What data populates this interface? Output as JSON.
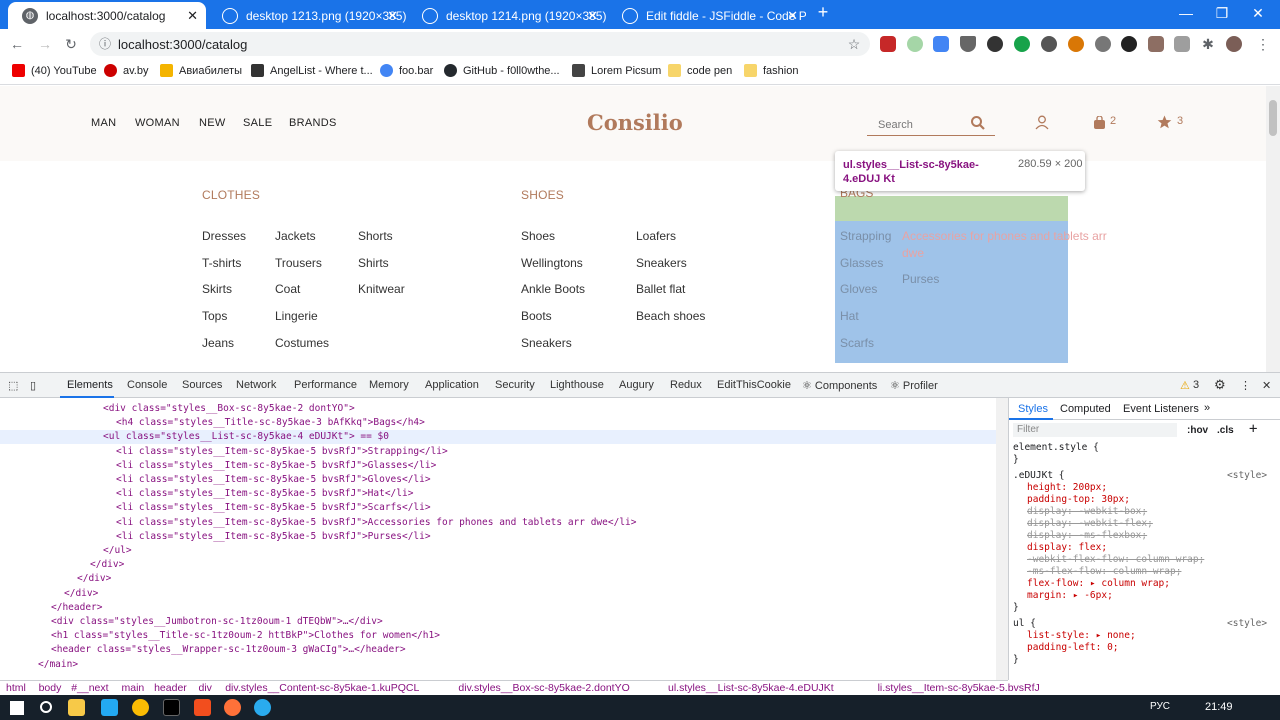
{
  "browser": {
    "tabs": [
      {
        "title": "localhost:3000/catalog",
        "active": true
      },
      {
        "title": "desktop 1213.png (1920×385)",
        "active": false
      },
      {
        "title": "desktop 1214.png (1920×385)",
        "active": false
      },
      {
        "title": "Edit fiddle - JSFiddle - Code Playg",
        "active": false
      }
    ],
    "new_tab": "+",
    "url": "localhost:3000/catalog",
    "bookmarks": [
      "(40) YouTube",
      "av.by",
      "Авиабилеты",
      "AngelList - Where t...",
      "foo.bar",
      "GitHub - f0ll0wthe...",
      "Lorem Picsum",
      "code pen",
      "fashion"
    ]
  },
  "site": {
    "nav": [
      "MAN",
      "WOMAN",
      "NEW",
      "SALE",
      "BRANDS"
    ],
    "logo": "Consilio",
    "search_placeholder": "Search",
    "cart_count": "2",
    "favorites_count": "3",
    "categories": {
      "clothes": {
        "title": "CLOTHES",
        "col1": [
          "Dresses",
          "T-shirts",
          "Skirts",
          "Tops",
          "Jeans"
        ],
        "col2": [
          "Jackets",
          "Trousers",
          "Coat",
          "Lingerie",
          "Costumes"
        ],
        "col3": [
          "Shorts",
          "Shirts",
          "Knitwear"
        ]
      },
      "shoes": {
        "title": "SHOES",
        "col1": [
          "Shoes",
          "Wellingtons",
          "Ankle Boots",
          "Boots",
          "Sneakers"
        ],
        "col2": [
          "Loafers",
          "Sneakers",
          "Ballet flat",
          "Beach shoes"
        ]
      },
      "bags": {
        "title": "BAGS",
        "col1": [
          "Strapping",
          "Glasses",
          "Gloves",
          "Hat",
          "Scarfs"
        ],
        "col2": [
          "Accessories for phones and tablets arr",
          "dwe",
          "Purses"
        ]
      }
    },
    "tooltip": {
      "selector": "ul.styles__List-sc-8y5kae-4.eDUJ Kt",
      "size": "280.59 × 200"
    }
  },
  "devtools": {
    "tabs": [
      "Elements",
      "Console",
      "Sources",
      "Network",
      "Performance",
      "Memory",
      "Application",
      "Security",
      "Lighthouse",
      "Augury",
      "Redux",
      "EditThisCookie",
      "⚛ Components",
      "⚛ Profiler"
    ],
    "warnings": "3",
    "dom_lines": [
      {
        "i": 5,
        "text": "<div class=\"styles__Box-sc-8y5kae-2 dontYO\">"
      },
      {
        "i": 6,
        "text": "<h4 class=\"styles__Title-sc-8y5kae-3 bAfKkq\">Bags</h4>"
      },
      {
        "i": 5,
        "text": "<ul class=\"styles__List-sc-8y5kae-4 eDUJKt\"> == $0"
      },
      {
        "i": 6,
        "text": "<li class=\"styles__Item-sc-8y5kae-5 bvsRfJ\">Strapping</li>"
      },
      {
        "i": 6,
        "text": "<li class=\"styles__Item-sc-8y5kae-5 bvsRfJ\">Glasses</li>"
      },
      {
        "i": 6,
        "text": "<li class=\"styles__Item-sc-8y5kae-5 bvsRfJ\">Gloves</li>"
      },
      {
        "i": 6,
        "text": "<li class=\"styles__Item-sc-8y5kae-5 bvsRfJ\">Hat</li>"
      },
      {
        "i": 6,
        "text": "<li class=\"styles__Item-sc-8y5kae-5 bvsRfJ\">Scarfs</li>"
      },
      {
        "i": 6,
        "text": "<li class=\"styles__Item-sc-8y5kae-5 bvsRfJ\">Accessories for phones and tablets arr dwe</li>"
      },
      {
        "i": 6,
        "text": "<li class=\"styles__Item-sc-8y5kae-5 bvsRfJ\">Purses</li>"
      },
      {
        "i": 5,
        "text": "</ul>"
      },
      {
        "i": 4,
        "text": "</div>"
      },
      {
        "i": 3,
        "text": "</div>"
      },
      {
        "i": 2,
        "text": "</div>"
      },
      {
        "i": 1,
        "text": "</header>"
      },
      {
        "i": 1,
        "text": "<div class=\"styles__Jumbotron-sc-1tz0oum-1 dTEQbW\">…</div>"
      },
      {
        "i": 1,
        "text": "<h1 class=\"styles__Title-sc-1tz0oum-2 httBkP\">Clothes for women</h1>"
      },
      {
        "i": 1,
        "text": "<header class=\"styles__Wrapper-sc-1tz0oum-3 gWaCIg\">…</header>"
      },
      {
        "i": 0,
        "text": "</main>"
      }
    ],
    "styles_tabs": [
      "Styles",
      "Computed",
      "Event Listeners",
      "»"
    ],
    "filter_placeholder": "Filter",
    "hov": ":hov",
    "cls": ".cls",
    "rules": [
      "element.style {",
      "}",
      ".eDUJKt {",
      "height: 200px;",
      "padding-top: 30px;",
      "display: -webkit-box;",
      "display: -webkit-flex;",
      "display: -ms-flexbox;",
      "display: flex;",
      "-webkit-flex-flow: column wrap;",
      "-ms-flex-flow: column wrap;",
      "flex-flow: ▸ column wrap;",
      "margin: ▸ -6px;",
      "}",
      "ul {",
      "list-style: ▸ none;",
      "padding-left: 0;",
      "}"
    ],
    "source": "<style>",
    "breadcrumbs": [
      "html",
      "body",
      "#__next",
      "main",
      "header",
      "div",
      "div.styles__Content-sc-8y5kae-1.kuPQCL",
      "div.styles__Box-sc-8y5kae-2.dontYO",
      "ul.styles__List-sc-8y5kae-4.eDUJKt",
      "li.styles__Item-sc-8y5kae-5.bvsRfJ"
    ]
  },
  "taskbar": {
    "lang": "РУС",
    "time": "21:49"
  }
}
